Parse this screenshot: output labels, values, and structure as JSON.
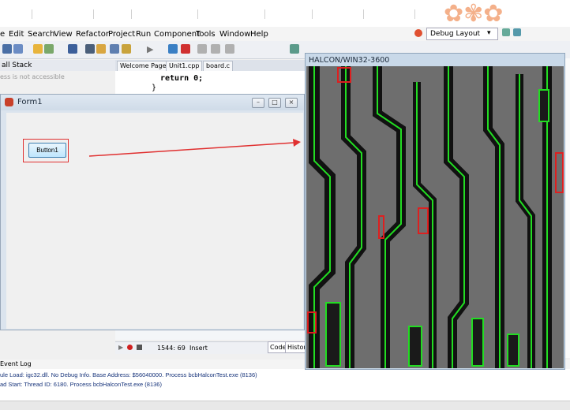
{
  "menu": [
    "e",
    "Edit",
    "Search",
    "View",
    "Refactor",
    "Project",
    "Run",
    "Component",
    "Tools",
    "Window",
    "Help"
  ],
  "layout_combo": "Debug Layout",
  "callstack": {
    "title": "all Stack",
    "message": "ess is not accessible"
  },
  "editor_tabs": [
    "Welcome Page",
    "Unit1.cpp",
    "board.c"
  ],
  "editor": {
    "code_line": "return 0;",
    "brace": "}"
  },
  "form1": {
    "title": "Form1",
    "button_label": "Button1"
  },
  "halcon": {
    "title": "HALCON/WIN32-3600"
  },
  "status": {
    "position": "1544: 69",
    "mode": "Insert",
    "tabs": [
      "Code",
      "History"
    ]
  },
  "event_log": {
    "title": "Event Log",
    "lines": [
      "ule Load: igc32.dll. No Debug Info. Base Address: $56040000. Process bcbHalconTest.exe (8136)",
      "ad Start: Thread ID: 6180. Process bcbHalconTest.exe (8136)"
    ]
  },
  "colors": {
    "accent_red": "#e03030",
    "trace_green": "#22dd22",
    "defect_red": "#dd2020"
  },
  "icons": [
    "window-minimize-icon",
    "window-restore-icon",
    "window-close-icon",
    "halcon-app-icon"
  ]
}
